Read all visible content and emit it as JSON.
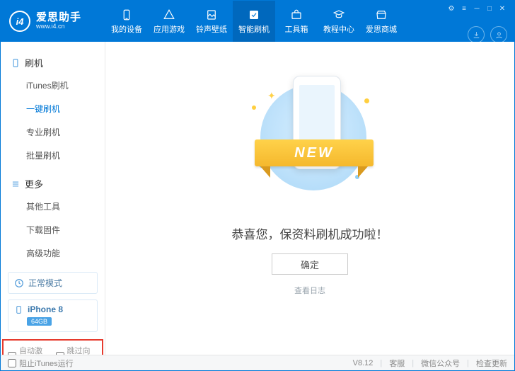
{
  "brand": {
    "name": "爱思助手",
    "domain": "www.i4.cn",
    "logo_text": "i4"
  },
  "nav": [
    {
      "label": "我的设备"
    },
    {
      "label": "应用游戏"
    },
    {
      "label": "铃声壁纸"
    },
    {
      "label": "智能刷机"
    },
    {
      "label": "工具箱"
    },
    {
      "label": "教程中心"
    },
    {
      "label": "爱思商城"
    }
  ],
  "sidebar": {
    "group1": {
      "title": "刷机",
      "items": [
        "iTunes刷机",
        "一键刷机",
        "专业刷机",
        "批量刷机"
      ]
    },
    "group2": {
      "title": "更多",
      "items": [
        "其他工具",
        "下载固件",
        "高级功能"
      ]
    }
  },
  "mode": {
    "label": "正常模式"
  },
  "device": {
    "name": "iPhone 8",
    "storage": "64GB"
  },
  "checks": {
    "auto_activate": "自动激活",
    "skip_guide": "跳过向导"
  },
  "main": {
    "ribbon": "NEW",
    "success": "恭喜您，保资料刷机成功啦！",
    "ok": "确定",
    "view_log": "查看日志"
  },
  "status": {
    "block_itunes": "阻止iTunes运行",
    "version": "V8.12",
    "support": "客服",
    "wechat": "微信公众号",
    "update": "检查更新"
  }
}
